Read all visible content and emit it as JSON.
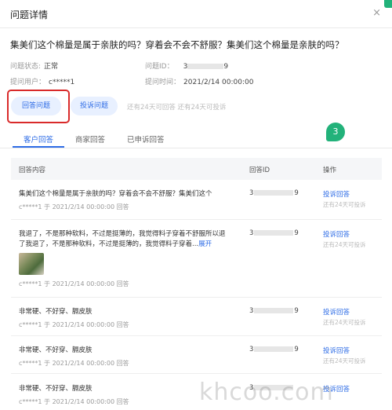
{
  "header": {
    "title": "问题详情",
    "close_glyph": "×"
  },
  "question": "集美们这个棉量是属于亲肤的吗？穿着会不会不舒服？集美们这个棉量是亲肤的吗？",
  "meta": {
    "status_label": "问题状态:",
    "status_value": "正常",
    "id_label": "问题ID：",
    "id_prefix": "3",
    "id_suffix": "9",
    "user_label": "提问用户：",
    "user_value": "c*****1",
    "time_label": "提问时间：",
    "time_value": "2021/2/14 00:00:00"
  },
  "actions": {
    "answer": "回答问题",
    "complain": "投诉问题",
    "hint": "还有24天可回答  还有24天可投诉"
  },
  "tabs": [
    "客户回答",
    "商家回答",
    "已申诉回答"
  ],
  "badge": "3",
  "table": {
    "headers": {
      "content": "回答内容",
      "answer_id": "回答ID",
      "action": "操作"
    },
    "rows": [
      {
        "content": "集美们这个棉量是属于亲肤的吗？穿着会不会不舒服？集美们这个",
        "byline": "c*****1 于 2021/2/14 00:00:00 回答",
        "id_prefix": "3",
        "id_suffix": "9",
        "op_link": "投诉回答",
        "op_hint": "还有24天可投诉"
      },
      {
        "content": "我退了，不是那种软料，不过是挺薄的，我觉得料子穿着不舒服所以退了我退了，不是那种软料，不过是挺薄的，我觉得料子穿着...",
        "expand": "展开",
        "byline": "c*****1 于 2021/2/14 00:00:00 回答",
        "id_prefix": "3",
        "id_suffix": "9",
        "op_link": "投诉回答",
        "op_hint": "还有24天可投诉"
      },
      {
        "content": "非常硬、不好穿、膈皮肤",
        "byline": "c*****1 于 2021/2/14 00:00:00 回答",
        "id_prefix": "3",
        "id_suffix": "9",
        "op_link": "投诉回答",
        "op_hint": "还有24天可投诉"
      },
      {
        "content": "非常硬、不好穿、膈皮肤",
        "byline": "c*****1 于 2021/2/14 00:00:00 回答",
        "id_prefix": "3",
        "id_suffix": "9",
        "op_link": "投诉回答",
        "op_hint": "还有24天可投诉"
      },
      {
        "content": "非常硬、不好穿、膈皮肤",
        "byline": "c*****1 于 2021/2/14 00:00:00 回答",
        "id_prefix": "3",
        "id_suffix": "",
        "op_link": "投诉回答",
        "op_hint": ""
      }
    ]
  },
  "watermark": "khcoo.com",
  "colors": {
    "accent": "#2e6ce6",
    "highlight": "#d92a2a",
    "badge": "#22b27a"
  }
}
